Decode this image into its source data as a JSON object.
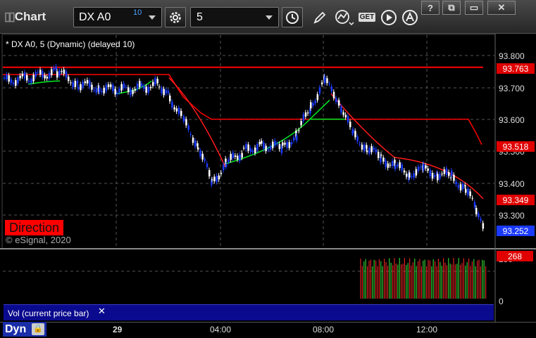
{
  "window": {
    "title": "Chart",
    "buttons": [
      "?",
      "⧉",
      "▭",
      "✕"
    ]
  },
  "toolbar": {
    "symbol": "DX A0",
    "delay_badge": "10",
    "interval": "5",
    "get_label": "GET"
  },
  "chart": {
    "legend": "* DX A0, 5 (Dynamic) (delayed 10)",
    "direction_label": "Direction",
    "copyright": "© eSignal, 2020",
    "price_axis_labels": [
      "93.800",
      "93.700",
      "93.600",
      "93.500",
      "93.400",
      "93.300"
    ],
    "price_tags": {
      "upper_line": "93.763",
      "stop_line": "93.518",
      "trail": "93.349",
      "last": "93.252"
    },
    "colors": {
      "up_candle": "#ffffff",
      "down_candle": "#1a3aff",
      "stop_line": "#ff0000",
      "trail_line": "#ff1a1a",
      "support_line": "#00ee22",
      "last_tag": "#1a3aff"
    }
  },
  "volume": {
    "title": "Vol (current price bar)",
    "close": "✕",
    "axis_labels": [
      "250",
      "0"
    ],
    "current_tag": "268"
  },
  "time_axis": {
    "dyn_label": "Dyn",
    "labels": [
      "29",
      "04:00",
      "08:00",
      "12:00"
    ]
  }
}
